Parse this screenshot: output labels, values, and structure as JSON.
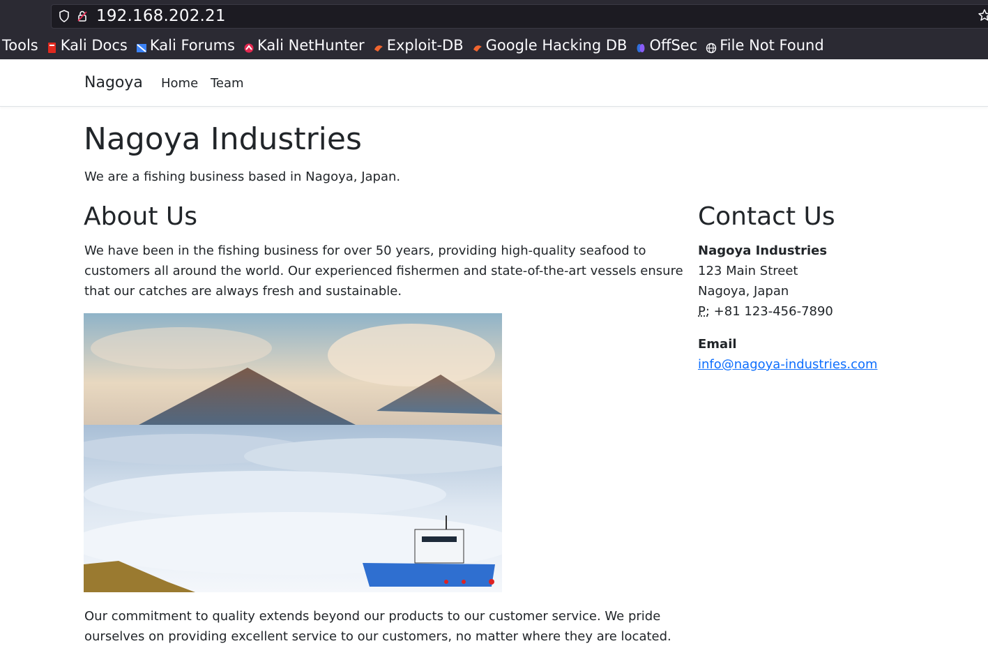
{
  "browser": {
    "url": "192.168.202.21",
    "bookmarks": [
      {
        "label": "Tools",
        "icon": "kali-dragon-icon"
      },
      {
        "label": "Kali Docs",
        "icon": "kali-docs-icon"
      },
      {
        "label": "Kali Forums",
        "icon": "kali-forums-icon"
      },
      {
        "label": "Kali NetHunter",
        "icon": "nethunter-icon"
      },
      {
        "label": "Exploit-DB",
        "icon": "exploit-db-icon"
      },
      {
        "label": "Google Hacking DB",
        "icon": "ghdb-icon"
      },
      {
        "label": "OffSec",
        "icon": "offsec-icon"
      },
      {
        "label": "File Not Found",
        "icon": "globe-icon"
      }
    ]
  },
  "nav": {
    "brand": "Nagoya",
    "links": [
      "Home",
      "Team"
    ]
  },
  "hero": {
    "title": "Nagoya Industries",
    "subtitle": "We are a fishing business based in Nagoya, Japan."
  },
  "about": {
    "title": "About Us",
    "p1": "We have been in the fishing business for over 50 years, providing high-quality seafood to customers all around the world. Our experienced fishermen and state-of-the-art vessels ensure that our catches are always fresh and sustainable.",
    "p2": "Our commitment to quality extends beyond our products to our customer service. We pride ourselves on providing excellent service to our customers, no matter where they are located."
  },
  "contact": {
    "title": "Contact Us",
    "company": "Nagoya Industries",
    "street": "123 Main Street",
    "city": "Nagoya, Japan",
    "phone_label": "P:",
    "phone": "+81 123-456-7890",
    "email_label": "Email",
    "email": "info@nagoya-industries.com"
  },
  "colors": {
    "chrome_bg": "#2b2a33",
    "link": "#0d6efd",
    "text": "#212529"
  }
}
